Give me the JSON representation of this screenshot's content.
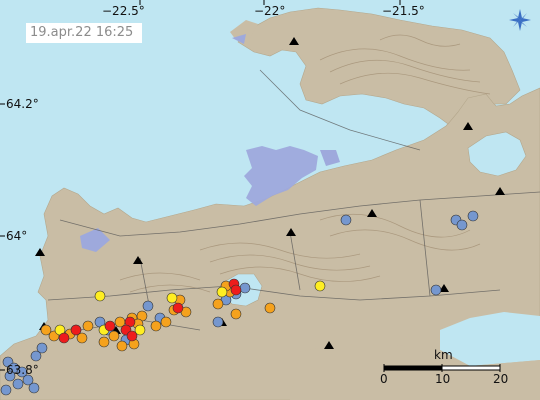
{
  "timestamp": "19.apr.22  16:25",
  "longitude_labels": [
    "−22.5°",
    "−22°",
    "−21.5°"
  ],
  "latitude_labels": [
    "64.2°",
    "64°",
    "63.8°"
  ],
  "scalebar": {
    "unit": "km",
    "ticks": [
      "0",
      "10",
      "20"
    ]
  },
  "compass": {
    "icon": "compass-rose-icon"
  },
  "colors": {
    "sea": "#bfe6f2",
    "land": "#c9bda5",
    "glacier_lake": "#9ea9dc",
    "contours": "#a39075",
    "roads": "#555555",
    "station": "#000000",
    "quake_red": "#ee1c1c",
    "quake_orange": "#f5a21d",
    "quake_yellow": "#ffee22",
    "quake_blue": "#7597cf"
  }
}
